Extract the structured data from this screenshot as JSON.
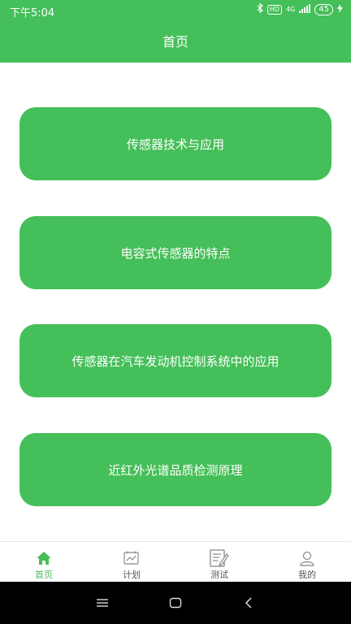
{
  "status_bar": {
    "time": "下午5:04",
    "hd": "HD",
    "network": "4G",
    "battery": "45"
  },
  "header": {
    "title": "首页"
  },
  "cards": [
    {
      "label": "传感器技术与应用"
    },
    {
      "label": "电容式传感器的特点"
    },
    {
      "label": "传感器在汽车发动机控制系统中的应用"
    },
    {
      "label": "近红外光谱品质检测原理"
    }
  ],
  "tabs": [
    {
      "label": "首页",
      "icon": "home-icon",
      "active": true
    },
    {
      "label": "计划",
      "icon": "plan-icon",
      "active": false
    },
    {
      "label": "测试",
      "icon": "test-icon",
      "active": false
    },
    {
      "label": "我的",
      "icon": "profile-icon",
      "active": false
    }
  ],
  "colors": {
    "accent": "#45bf59",
    "tab_inactive": "#555555"
  }
}
